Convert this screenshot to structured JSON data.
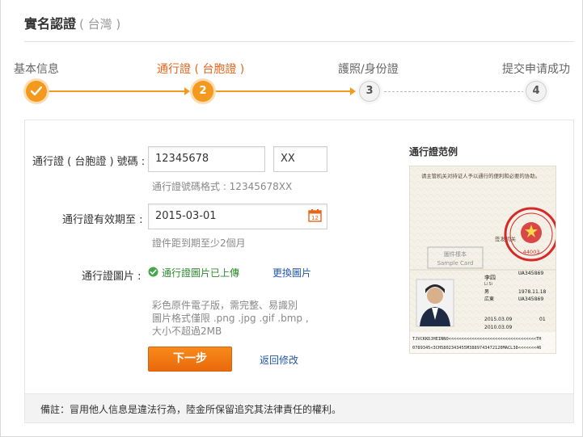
{
  "header": {
    "title": "實名認證",
    "subtitle": "( 台灣 )"
  },
  "steps": [
    {
      "label": "基本信息",
      "number": "",
      "state": "done"
    },
    {
      "label": "通行證 ( 台胞證 )",
      "number": "2",
      "state": "current"
    },
    {
      "label": "護照/身份證",
      "number": "3",
      "state": "todo"
    },
    {
      "label": "提交申请成功",
      "number": "4",
      "state": "todo"
    }
  ],
  "form": {
    "permit_number": {
      "label": "通行證 ( 台胞證 ) 號碼 :",
      "value": "12345678",
      "suffix_value": "XX",
      "hint": "通行證號碼格式 : 12345678XX"
    },
    "expiry": {
      "label": "通行證有效期至 :",
      "value": "2015-03-01",
      "calendar_day": "12",
      "hint": "證件距到期至少2個月"
    },
    "image": {
      "label": "通行證圖片 :",
      "status": "通行證圖片已上傳",
      "change_link": "更換圖片",
      "notes": [
        "彩色原件電子版，需完整、易識別",
        "圖片格式僅限 .png .jpg .gif .bmp ,",
        "大小不超過2MB"
      ]
    },
    "next_button": "下一步",
    "back_link": "返回修改"
  },
  "sample": {
    "title": "通行證范例",
    "card_text_top": "请主管机关对持证人予以通行的便利和必要的协助。",
    "issuer": "签发机关",
    "stamp_code": "44003",
    "watermark": [
      "圖件樣本",
      "Sample Card"
    ],
    "name_cn": "李四",
    "name_pinyin": "Li Si",
    "card_number": "UA345869",
    "sex": "男",
    "birth_date": "1978.11.18",
    "birth_place": "広東",
    "expiry_date": "2015.03.09",
    "issue_date": "2010.03.09",
    "issue_count": "01",
    "mrz_line1": "TJVCKKDJHEINNO<<<<<<<<<<<<<<<<<<<<<<<<<<<<<<<<<<TH",
    "mrz_line2": "0789345<3CH5802343455M3889743472120MACL38<<<<<<<46"
  },
  "footer": {
    "note": "備註：冒用他人信息是違法行為，陸金所保留追究其法律責任的權利。"
  },
  "colors": {
    "accent": "#f39a1e",
    "active_text": "#e8641b",
    "success": "#2e8b2e",
    "link": "#2156a5"
  }
}
